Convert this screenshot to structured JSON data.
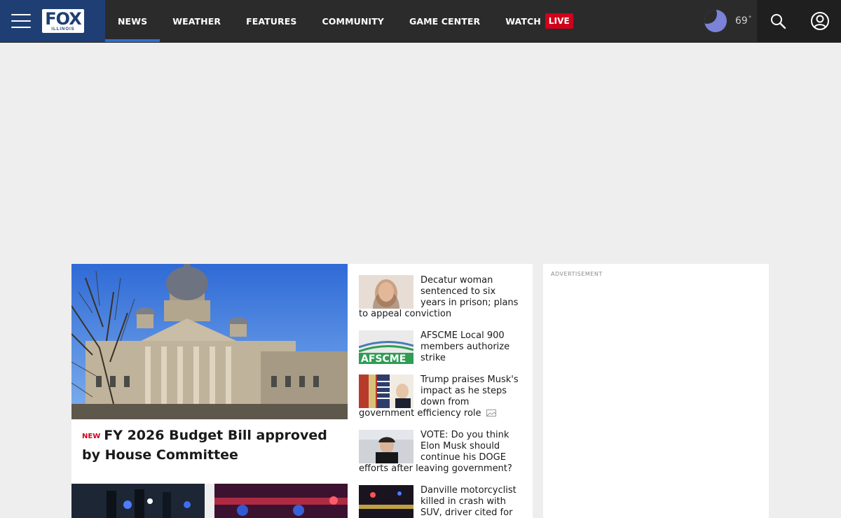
{
  "header": {
    "logo_text": "FOX",
    "logo_state": "ILLINOIS",
    "nav": [
      {
        "label": "NEWS"
      },
      {
        "label": "WEATHER"
      },
      {
        "label": "FEATURES"
      },
      {
        "label": "COMMUNITY"
      },
      {
        "label": "GAME CENTER"
      },
      {
        "label": "WATCH"
      }
    ],
    "live_label": "LIVE",
    "weather": {
      "temperature": "69",
      "degree": "°",
      "condition_icon": "moon-icon"
    },
    "colors": {
      "brand": "#1f3f74",
      "header_bg": "#2b2b2b",
      "active_underline": "#2e6fd1",
      "live": "#d0021b"
    }
  },
  "hero": {
    "badge": "NEW",
    "title": "FY 2026 Budget Bill approved by House Committee"
  },
  "stories": [
    {
      "headline": "Decatur woman sentenced to six years in prison; plans to appeal conviction"
    },
    {
      "headline": "AFSCME Local 900 members authorize strike"
    },
    {
      "headline": "Trump praises Musk's impact as he steps down from government efficiency role"
    },
    {
      "headline": "VOTE: Do you think Elon Musk should continue his DOGE efforts after leaving government?"
    },
    {
      "headline": "Danville motorcyclist killed in crash with SUV, driver cited for"
    }
  ],
  "ad_side": {
    "label": "ADVERTISEMENT"
  }
}
